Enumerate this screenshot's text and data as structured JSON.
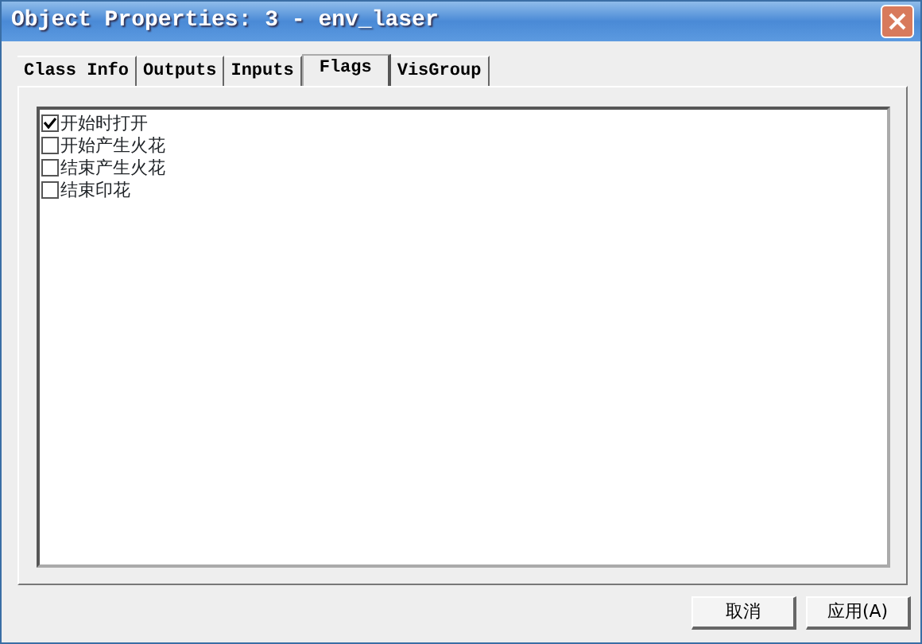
{
  "window": {
    "title": "Object Properties: 3 - env_laser"
  },
  "tabs": [
    {
      "label": "Class Info",
      "selected": false
    },
    {
      "label": "Outputs",
      "selected": false
    },
    {
      "label": "Inputs",
      "selected": false
    },
    {
      "label": "Flags",
      "selected": true
    },
    {
      "label": "VisGroup",
      "selected": false
    }
  ],
  "flags": [
    {
      "label": "开始时打开",
      "checked": true
    },
    {
      "label": "开始产生火花",
      "checked": false
    },
    {
      "label": "结束产生火花",
      "checked": false
    },
    {
      "label": "结束印花",
      "checked": false
    }
  ],
  "buttons": [
    "取消",
    "应用(A)"
  ]
}
